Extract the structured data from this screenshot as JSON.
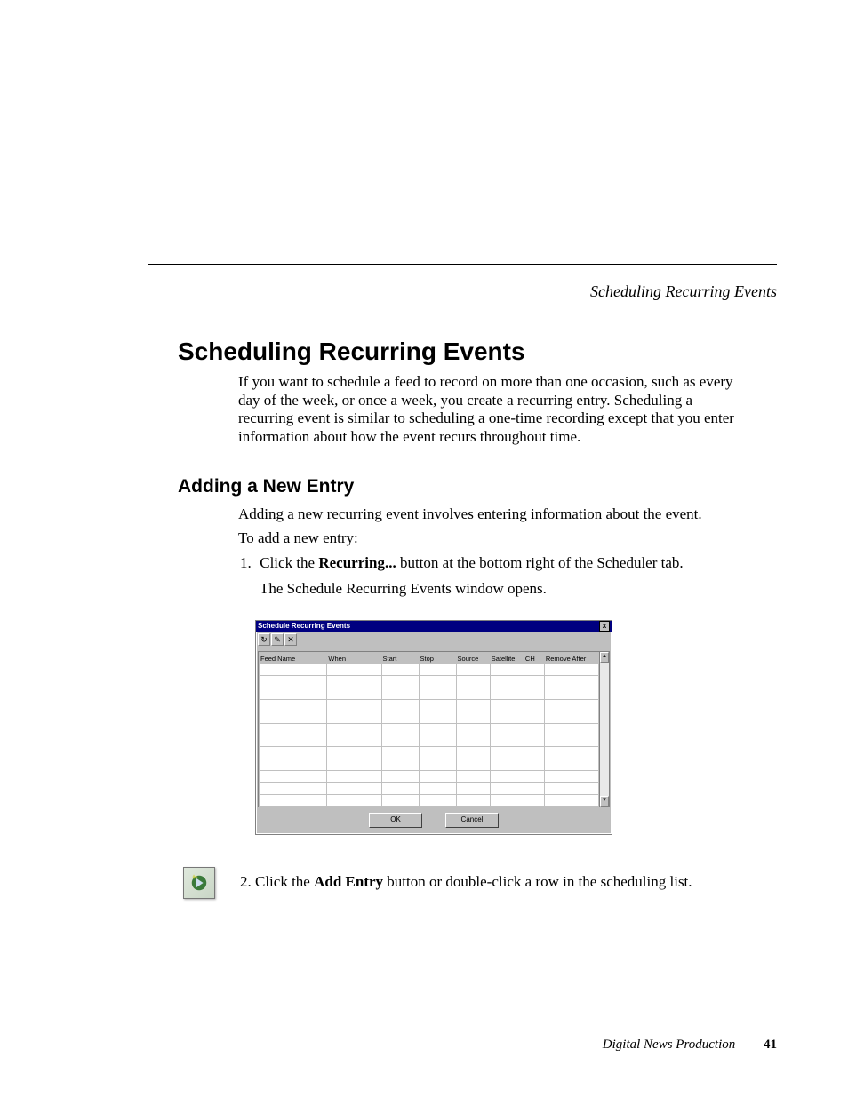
{
  "running_head": "Scheduling Recurring Events",
  "h1": "Scheduling Recurring Events",
  "intro": "If you want to schedule a feed to record on more than one occasion, such as every day of the week, or once a week, you create a recurring entry. Scheduling a recurring event is similar to scheduling a one-time recording except that you enter information about how the event recurs throughout time.",
  "h2": "Adding a New Entry",
  "body2_1": "Adding a new recurring event involves entering information about the event.",
  "body2_2": "To add a new entry:",
  "step1_pre": "Click the ",
  "step1_bold": "Recurring...",
  "step1_post": " button at the bottom right of the Scheduler tab.",
  "step1_sub": "The Schedule Recurring Events window opens.",
  "step2_pre": "Click the ",
  "step2_bold": "Add Entry",
  "step2_post": " button or double-click a row in the scheduling list.",
  "window": {
    "title": "Schedule Recurring Events",
    "close": "x",
    "toolbar": [
      "↻",
      "✎",
      "✕"
    ],
    "columns": [
      "Feed Name",
      "When",
      "Start",
      "Stop",
      "Source",
      "Satellite",
      "CH",
      "Remove After"
    ],
    "ok": "OK",
    "ok_u": "O",
    "cancel": "Cancel",
    "cancel_u": "C"
  },
  "footer": {
    "book": "Digital News Production",
    "page": "41"
  }
}
